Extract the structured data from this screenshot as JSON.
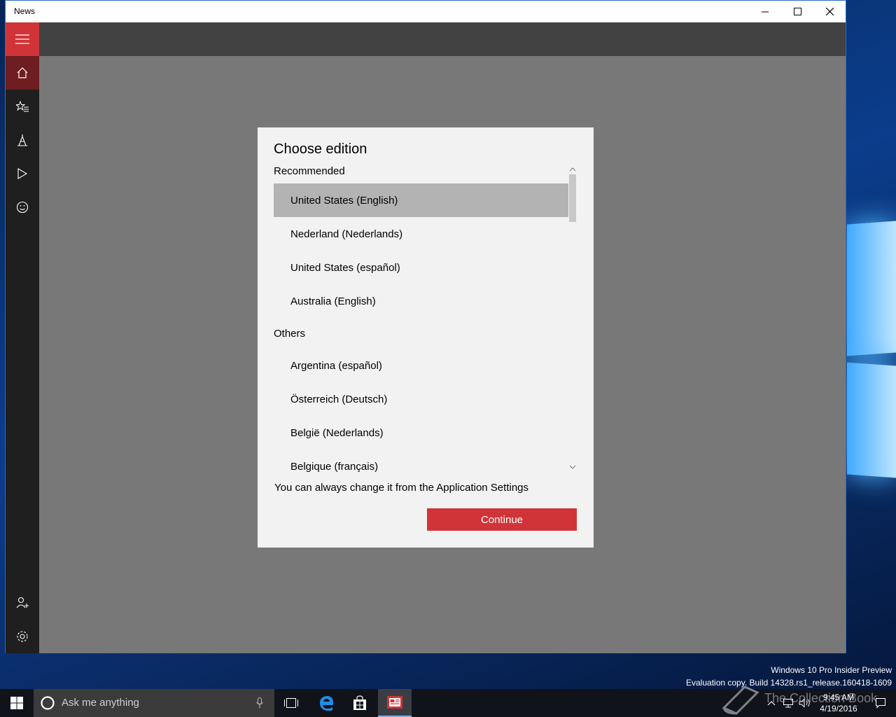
{
  "window": {
    "title": "News"
  },
  "dialog": {
    "title": "Choose edition",
    "groups": [
      {
        "header": "Recommended",
        "items": [
          "United States (English)",
          "Nederland (Nederlands)",
          "United States (español)",
          "Australia (English)"
        ]
      },
      {
        "header": "Others",
        "items": [
          "Argentina (español)",
          "Österreich (Deutsch)",
          "België (Nederlands)",
          "Belgique (français)"
        ]
      }
    ],
    "selected_item": "United States (English)",
    "hint": "You can always change it from the Application Settings",
    "continue_label": "Continue"
  },
  "desktop": {
    "edition_line": "Windows 10 Pro Insider Preview",
    "build_line": "Evaluation copy. Build 14328.rs1_release.160418-1609"
  },
  "taskbar": {
    "search_placeholder": "Ask me anything",
    "time": "9:45 AM",
    "date": "4/19/2016"
  },
  "watermark": {
    "text": "The Collection Book"
  },
  "colors": {
    "accent": "#d13438",
    "nav_rail": "#1f1f1f",
    "dialog_bg": "#f2f2f2",
    "selected_row": "#b3b3b3"
  }
}
